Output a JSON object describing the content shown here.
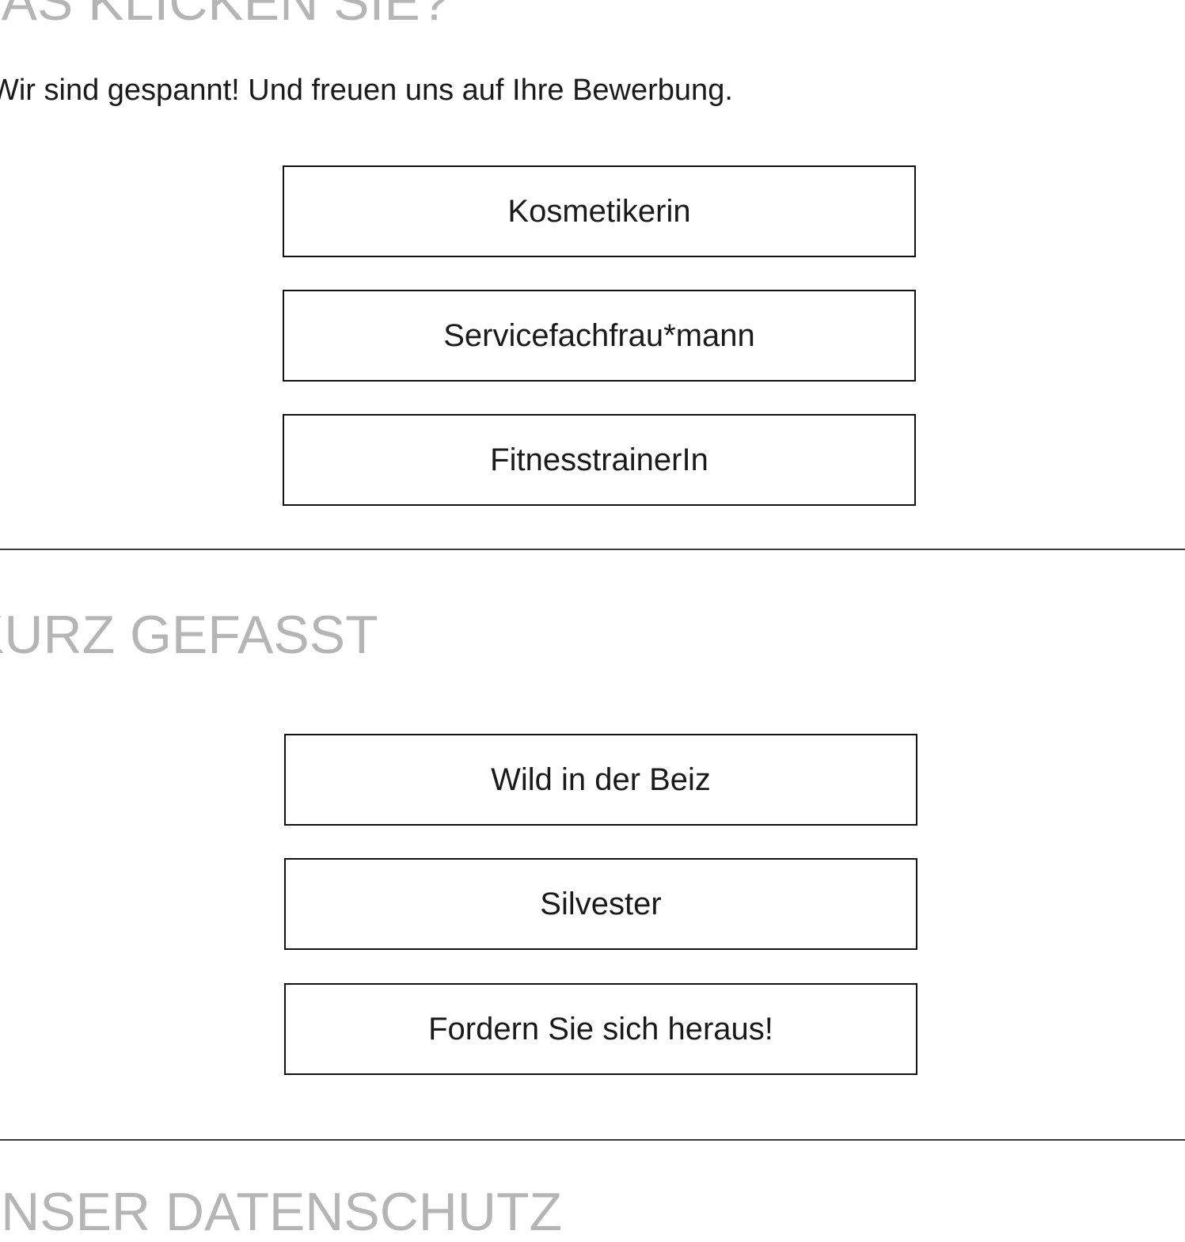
{
  "section1": {
    "heading": "WAS KLICKEN SIE?",
    "intro": "Wir sind gespannt! Und freuen uns auf Ihre Bewerbung.",
    "buttons": [
      {
        "label": "Kosmetikerin"
      },
      {
        "label": "Servicefachfrau*mann"
      },
      {
        "label": "FitnesstrainerIn"
      }
    ]
  },
  "section2": {
    "heading": "KURZ GEFASST",
    "buttons": [
      {
        "label": "Wild in der Beiz"
      },
      {
        "label": "Silvester"
      },
      {
        "label": "Fordern Sie sich heraus!"
      }
    ]
  },
  "section3": {
    "heading": "UNSER DATENSCHUTZ"
  },
  "colors": {
    "heading": "#b5b5b5",
    "text": "#1a1a1a",
    "button_border": "#111111",
    "divider": "#3a3a3a",
    "background": "#ffffff"
  }
}
